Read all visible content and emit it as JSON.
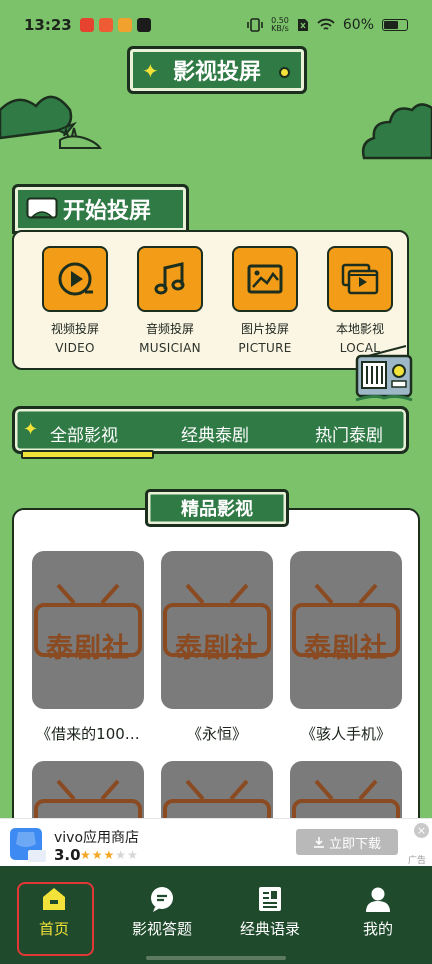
{
  "status_bar": {
    "time": "13:23",
    "net_speed_value": "0.50",
    "net_speed_unit": "KB/s",
    "battery": "60%",
    "icons": [
      "app-icon-red",
      "app-icon-red-2",
      "app-icon-orange",
      "tiktok-icon",
      "vibrate-icon",
      "sim-icon",
      "wifi-icon",
      "battery-icon"
    ]
  },
  "header": {
    "title": "影视投屏"
  },
  "start_section": {
    "title": "开始投屏",
    "tiles": [
      {
        "label": "视频投屏",
        "sub": "VIDEO",
        "icon": "play-icon"
      },
      {
        "label": "音频投屏",
        "sub": "MUSICIAN",
        "icon": "music-note-icon"
      },
      {
        "label": "图片投屏",
        "sub": "PICTURE",
        "icon": "picture-icon"
      },
      {
        "label": "本地影视",
        "sub": "LOCAL",
        "icon": "local-video-icon"
      }
    ]
  },
  "tabs": {
    "items": [
      "全部影视",
      "经典泰剧",
      "热门泰剧"
    ],
    "active_index": 0
  },
  "featured": {
    "title": "精品影视",
    "placeholder_logo_text": "泰剧社",
    "cards": [
      {
        "caption": "《借来的100…"
      },
      {
        "caption": "《永恒》"
      },
      {
        "caption": "《骇人手机》"
      }
    ]
  },
  "ad": {
    "app_name": "vivo应用商店",
    "rating": "3.0",
    "stars_filled": 3,
    "stars_total": 5,
    "download_label": "立即下载",
    "ad_label": "广告",
    "close_label": "×"
  },
  "bottom_nav": {
    "items": [
      {
        "label": "首页",
        "icon": "home-icon"
      },
      {
        "label": "影视答题",
        "icon": "chat-bubble-icon"
      },
      {
        "label": "经典语录",
        "icon": "document-icon"
      },
      {
        "label": "我的",
        "icon": "user-icon"
      }
    ],
    "active_index": 0
  },
  "colors": {
    "background": "#7cc26a",
    "primary_green": "#2f7a45",
    "accent_yellow": "#f3e23a",
    "tile_orange": "#f39c17",
    "nav_bg": "#1f4a2c",
    "highlight_red": "#e23737"
  }
}
